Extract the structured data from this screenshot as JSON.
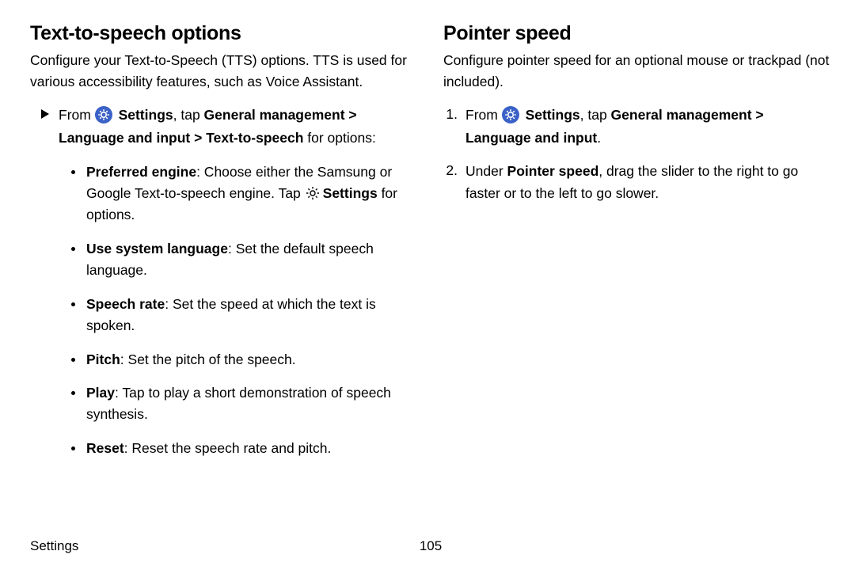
{
  "left": {
    "heading": "Text-to-speech options",
    "intro": "Configure your Text-to-Speech (TTS) options. TTS is used for various accessibility features, such as Voice Assistant.",
    "from_lead": "From",
    "settings_label": "Settings",
    "tap": ", tap ",
    "nav1": "General management",
    "nav2": "Language and input",
    "nav3": "Text-to-speech",
    "for_options": " for options:",
    "items": [
      {
        "title": "Preferred engine",
        "text_pre": ": Choose either the Samsung or Google Text-to-speech engine. Tap ",
        "settings_word": "Settings",
        "text_post": " for options."
      },
      {
        "title": "Use system language",
        "text_pre": ": Set the default speech language."
      },
      {
        "title": "Speech rate",
        "text_pre": ": Set the speed at which the text is spoken."
      },
      {
        "title": "Pitch",
        "text_pre": ": Set the pitch of the speech."
      },
      {
        "title": "Play",
        "text_pre": ": Tap to play a short demonstration of speech synthesis."
      },
      {
        "title": "Reset",
        "text_pre": ": Reset the speech rate and pitch."
      }
    ]
  },
  "right": {
    "heading": "Pointer speed",
    "intro": "Configure pointer speed for an optional mouse or trackpad (not included).",
    "step1_lead": "From",
    "step1_settings": "Settings",
    "step1_tap": ", tap ",
    "step1_nav1": "General management",
    "step1_nav2": "Language and input",
    "step1_period": ".",
    "step2_under": "Under ",
    "step2_bold": "Pointer speed",
    "step2_rest": ", drag the slider to the right to go faster or to the left to go slower."
  },
  "footer": {
    "section": "Settings",
    "page": "105"
  }
}
